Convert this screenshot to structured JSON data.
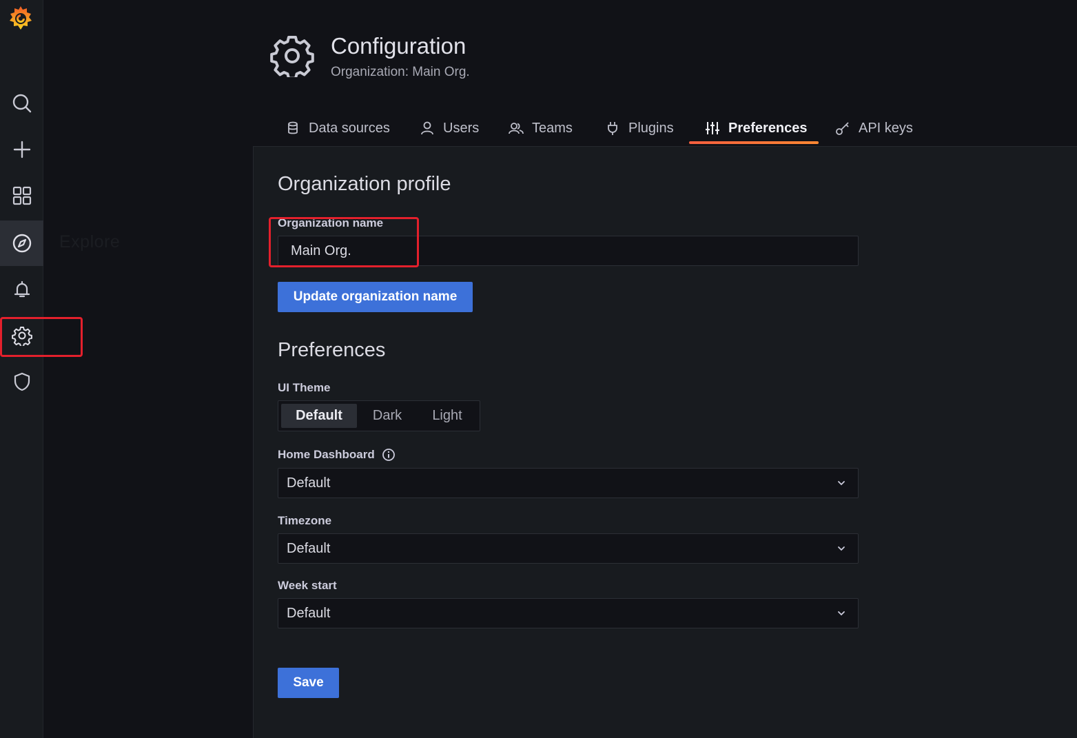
{
  "nav": {
    "items": [
      "search-icon",
      "plus-icon",
      "dashboards-icon",
      "explore-icon",
      "bell-icon",
      "gear-icon",
      "shield-icon"
    ],
    "explore_label": "Explore"
  },
  "header": {
    "title": "Configuration",
    "subtitle": "Organization: Main Org."
  },
  "tabs": [
    {
      "label": "Data sources",
      "icon": "database-icon"
    },
    {
      "label": "Users",
      "icon": "user-icon"
    },
    {
      "label": "Teams",
      "icon": "users-icon"
    },
    {
      "label": "Plugins",
      "icon": "plug-icon"
    },
    {
      "label": "Preferences",
      "icon": "sliders-icon",
      "active": true
    },
    {
      "label": "API keys",
      "icon": "key-icon"
    }
  ],
  "org_profile": {
    "title": "Organization profile",
    "name_label": "Organization name",
    "name_value": "Main Org.",
    "update_button": "Update organization name"
  },
  "preferences": {
    "title": "Preferences",
    "ui_theme_label": "UI Theme",
    "ui_theme_options": [
      "Default",
      "Dark",
      "Light"
    ],
    "ui_theme_selected": "Default",
    "home_dashboard_label": "Home Dashboard",
    "home_dashboard_value": "Default",
    "timezone_label": "Timezone",
    "timezone_value": "Default",
    "week_start_label": "Week start",
    "week_start_value": "Default",
    "save_button": "Save"
  },
  "colors": {
    "accent": "#3d71d9",
    "tab_underline": "#f55f3e",
    "annotation": "#e3202c"
  }
}
